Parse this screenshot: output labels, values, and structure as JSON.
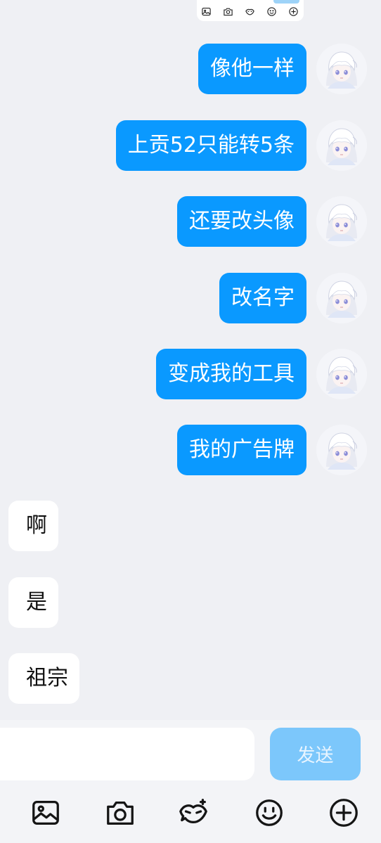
{
  "quoted_preview": {
    "icons": [
      "image-icon",
      "camera-icon",
      "sticker-icon",
      "emoji-icon",
      "plus-icon"
    ]
  },
  "messages_sent": [
    {
      "text": "像他一样"
    },
    {
      "text": "上贡52只能转5条"
    },
    {
      "text": "还要改头像"
    },
    {
      "text": "改名字"
    },
    {
      "text": "变成我的工具"
    },
    {
      "text": "我的广告牌"
    }
  ],
  "messages_received": [
    {
      "text": "啊"
    },
    {
      "text": "是"
    },
    {
      "text": "祖宗"
    }
  ],
  "input": {
    "value": "",
    "send_label": "发送"
  },
  "toolbar": {
    "icons": [
      "image-icon",
      "camera-icon",
      "sticker-icon",
      "emoji-icon",
      "plus-icon"
    ]
  },
  "colors": {
    "sent_bubble": "#0a99ff",
    "received_bubble": "#ffffff",
    "background": "#eff0f4",
    "send_button": "#7cc7fb"
  }
}
